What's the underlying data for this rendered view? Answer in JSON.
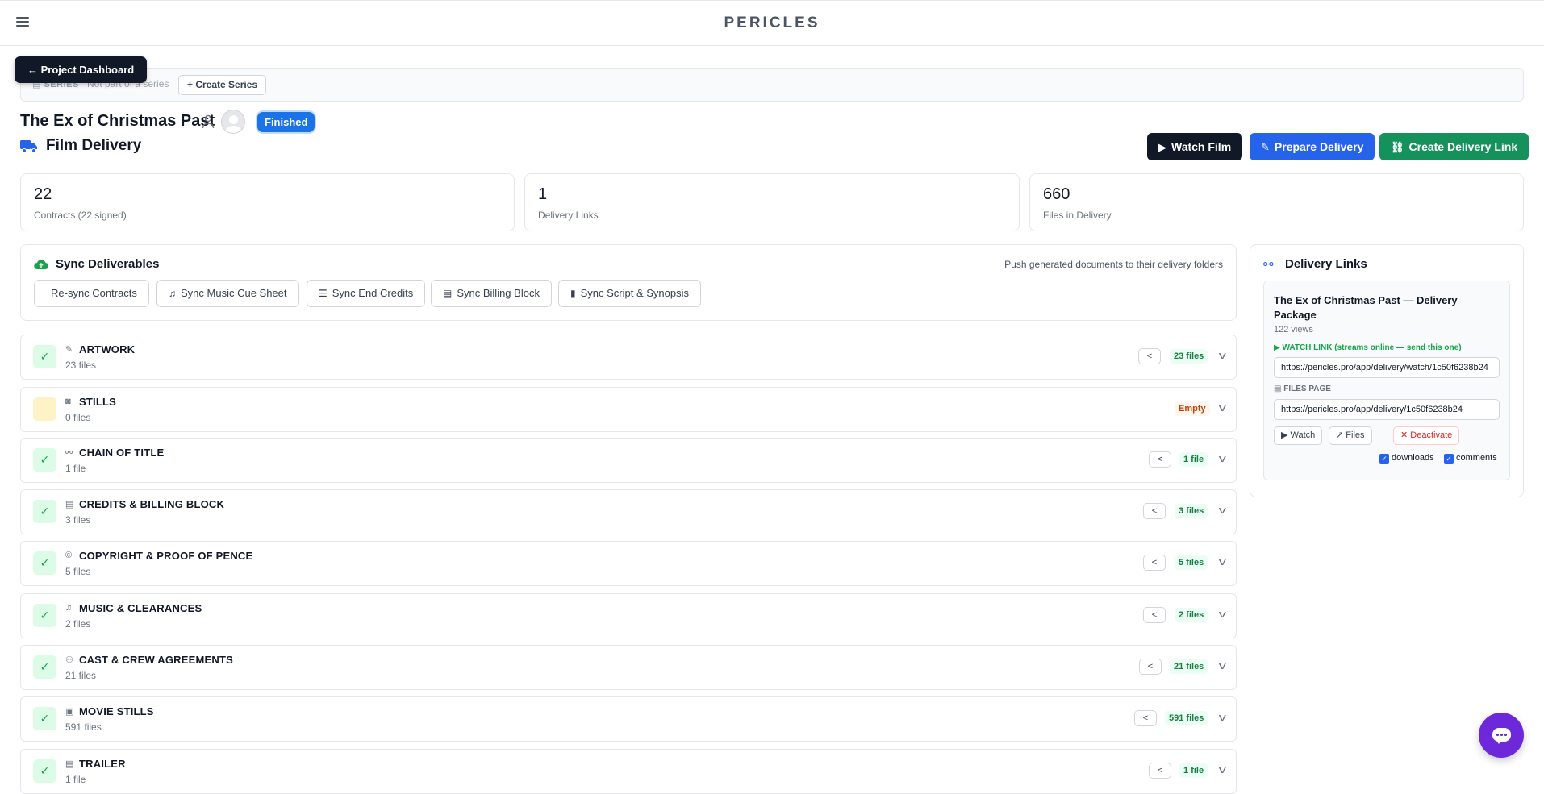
{
  "app": {
    "brand": "PERICLES"
  },
  "series": {
    "tag": "SERIES",
    "status": "Not part of a series",
    "create_label": "+ Create Series"
  },
  "nav": {
    "dashboard_label": "← Project Dashboard"
  },
  "film": {
    "title": "The Ex of Christmas Past",
    "status": "Finished",
    "section_title": "Film Delivery"
  },
  "actions": {
    "watch": "Watch Film",
    "prepare": "Prepare Delivery",
    "create_link": "Create Delivery Link"
  },
  "stats": [
    {
      "value": "22",
      "label": "Contracts (22 signed)"
    },
    {
      "value": "1",
      "label": "Delivery Links"
    },
    {
      "value": "660",
      "label": "Files in Delivery"
    }
  ],
  "sync": {
    "title": "Sync Deliverables",
    "note": "Push generated documents to their delivery folders",
    "buttons": [
      "Re-sync Contracts",
      "Sync Music Cue Sheet",
      "Sync End Credits",
      "Sync Billing Block",
      "Sync Script & Synopsis"
    ]
  },
  "categories": [
    {
      "name": "ARTWORK",
      "count": "23 files",
      "badge": "23 files",
      "icon": "brush-icon",
      "empty": false
    },
    {
      "name": "STILLS",
      "count": "0 files",
      "badge": "Empty",
      "icon": "camera-icon",
      "empty": true
    },
    {
      "name": "CHAIN OF TITLE",
      "count": "1 file",
      "badge": "1 file",
      "icon": "link-icon",
      "empty": false
    },
    {
      "name": "CREDITS & BILLING BLOCK",
      "count": "3 files",
      "badge": "3 files",
      "icon": "list-icon",
      "empty": false
    },
    {
      "name": "COPYRIGHT & PROOF OF PENCE",
      "count": "5 files",
      "badge": "5 files",
      "icon": "copyright-icon",
      "empty": false
    },
    {
      "name": "MUSIC & CLEARANCES",
      "count": "2 files",
      "badge": "2 files",
      "icon": "music-icon",
      "empty": false
    },
    {
      "name": "CAST & CREW AGREEMENTS",
      "count": "21 files",
      "badge": "21 files",
      "icon": "people-icon",
      "empty": false
    },
    {
      "name": "MOVIE STILLS",
      "count": "591 files",
      "badge": "591 files",
      "icon": "image-icon",
      "empty": false
    },
    {
      "name": "TRAILER",
      "count": "1 file",
      "badge": "1 file",
      "icon": "film-icon",
      "empty": false
    }
  ],
  "delivery_links": {
    "title": "Delivery Links",
    "card": {
      "name": "The Ex of Christmas Past — Delivery Package",
      "views": "122 views",
      "watch_label": "▶ WATCH LINK (streams online — send this one)",
      "watch_url": "https://pericles.pro/app/delivery/watch/1c50f6238b24",
      "files_label": "FILES PAGE",
      "files_url": "https://pericles.pro/app/delivery/1c50f6238b24",
      "watch_btn": "Watch",
      "files_btn": "Files",
      "deactivate_btn": "Deactivate",
      "opt_downloads": "downloads",
      "opt_comments": "comments"
    }
  },
  "colors": {
    "accent_blue": "#2563eb",
    "accent_green": "#15925c",
    "dark": "#111827",
    "status_blue": "#1a73e8",
    "chat_purple": "#6d28d9"
  }
}
